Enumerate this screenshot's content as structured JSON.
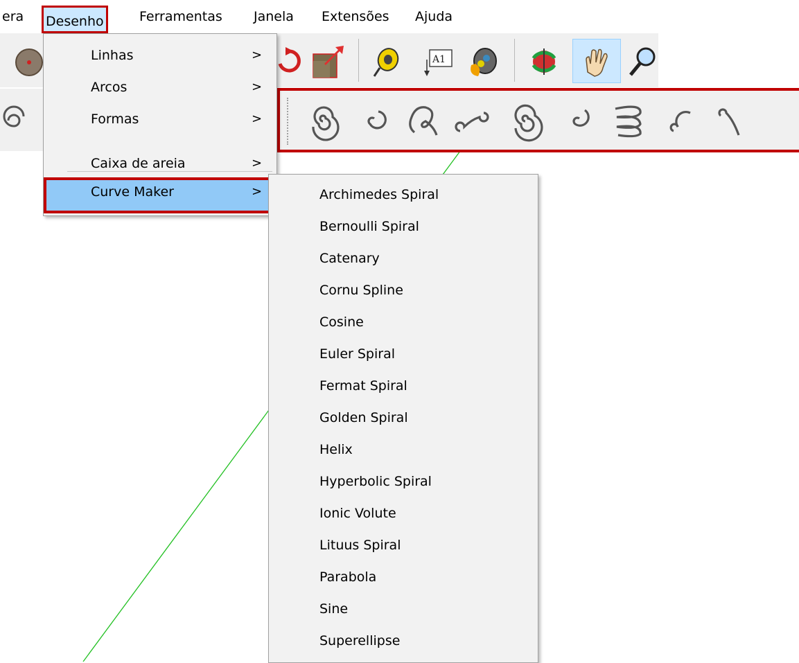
{
  "menubar": {
    "items": [
      "era",
      "Desenho",
      "Ferramentas",
      "Janela",
      "Extensões",
      "Ajuda"
    ]
  },
  "toolbar": {
    "icons": [
      "circle-tool-icon",
      "rotate-icon",
      "scale-icon",
      "tape-measure-icon",
      "text-label-icon",
      "paint-bucket-icon",
      "orbit-icon",
      "pan-hand-icon",
      "zoom-icon"
    ]
  },
  "curve_toolbar": {
    "icons": [
      "archimedes-spiral-icon",
      "bernoulli-spiral-icon",
      "catenary-icon",
      "cornu-spline-icon",
      "fermat-spiral-icon",
      "euler-spiral-icon",
      "helix-icon",
      "golden-spiral-icon",
      "hyperbolic-spiral-icon"
    ]
  },
  "draw_menu": {
    "items": [
      {
        "label": "Linhas",
        "arrow": ">"
      },
      {
        "label": "Arcos",
        "arrow": ">"
      },
      {
        "label": "Formas",
        "arrow": ">"
      },
      {
        "label": "Caixa de areia",
        "arrow": ">"
      },
      {
        "label": "Curve Maker",
        "arrow": ">"
      }
    ]
  },
  "curve_maker_menu": {
    "items": [
      "Archimedes Spiral",
      "Bernoulli Spiral",
      "Catenary",
      "Cornu Spline",
      "Cosine",
      "Euler Spiral",
      "Fermat Spiral",
      "Golden Spiral",
      "Helix",
      "Hyperbolic Spiral",
      "Ionic Volute",
      "Lituus Spiral",
      "Parabola",
      "Sine",
      "Superellipse"
    ]
  },
  "colors": {
    "highlight_border": "#c00000",
    "menu_hover": "#91c9f7",
    "axis_green": "#00c000"
  }
}
